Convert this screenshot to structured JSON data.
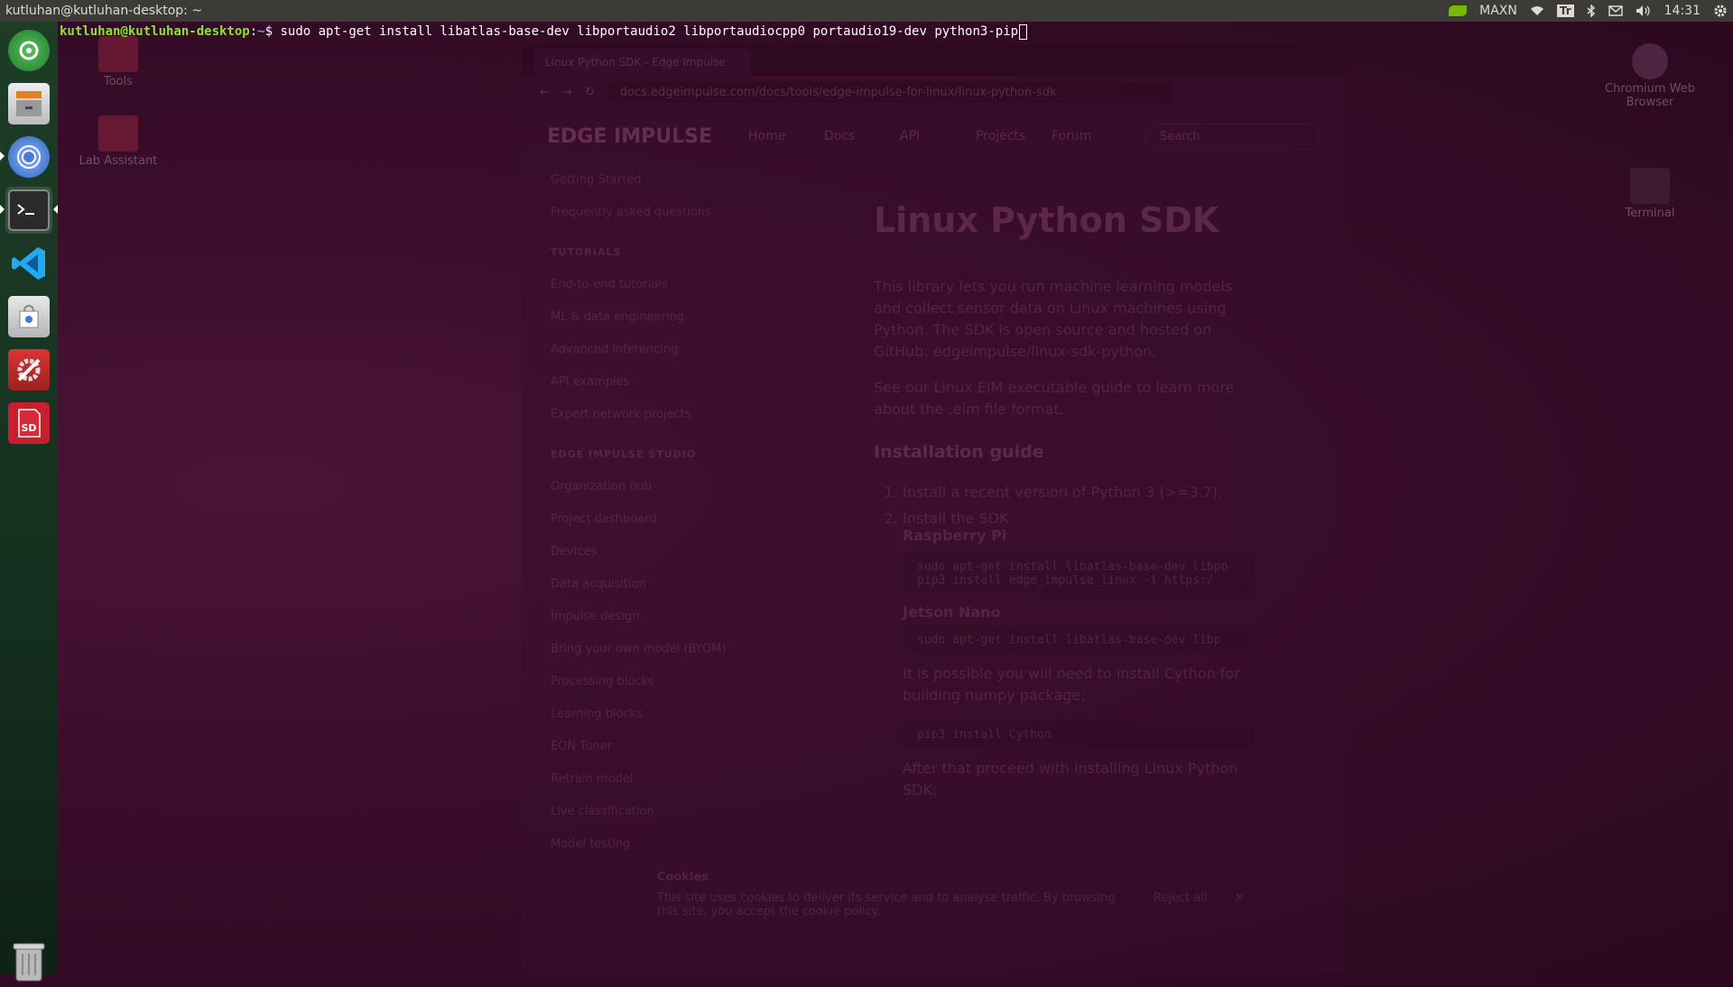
{
  "top_panel": {
    "window_title": "kutluhan@kutluhan-desktop: ~",
    "power_mode": "MAXN",
    "keyboard_layout": "Tr",
    "clock": "14:31",
    "icons": [
      "nvidia-icon",
      "wifi-icon",
      "keyboard-layout-icon",
      "bluetooth-icon",
      "mail-icon",
      "volume-icon",
      "settings-gear-icon"
    ]
  },
  "launcher": {
    "items": [
      {
        "name": "ubuntu-software-updater",
        "icon": "updater-icon"
      },
      {
        "name": "files",
        "icon": "file-cabinet-icon"
      },
      {
        "name": "chromium",
        "icon": "chromium-icon"
      },
      {
        "name": "terminal",
        "icon": "terminal-icon",
        "active": true
      },
      {
        "name": "vscode",
        "icon": "vscode-icon"
      },
      {
        "name": "software-center",
        "icon": "shopping-bag-icon"
      },
      {
        "name": "system-settings",
        "icon": "tools-icon"
      },
      {
        "name": "sd-card-formatter",
        "icon": "sd-card-icon"
      }
    ],
    "trash_icon": "trash-icon"
  },
  "desktop_icons": [
    {
      "label": "Tools"
    },
    {
      "label": "Lab Assistant"
    },
    {
      "label": "Chromium Web Browser"
    },
    {
      "label": "Terminal"
    }
  ],
  "terminal": {
    "user_host": "kutluhan@kutluhan-desktop",
    "separator": ":",
    "path": "~",
    "prompt_symbol": "$",
    "command": " sudo apt-get install libatlas-base-dev libportaudio2 libportaudiocpp0 portaudio19-dev python3-pip"
  },
  "browser": {
    "tab_title": "Linux Python SDK - Edge Impulse",
    "url": "docs.edgeimpulse.com/docs/tools/edge-impulse-for-linux/linux-python-sdk",
    "logo": "EDGE IMPULSE",
    "nav": [
      "Home",
      "Docs",
      "API",
      "Projects",
      "Forum"
    ],
    "search_placeholder": "Search",
    "sidebar": [
      "Getting Started",
      "Frequently asked questions",
      "TUTORIALS",
      "End-to-end tutorials",
      "ML & data engineering",
      "Advanced inferencing",
      "API examples",
      "Expert network projects",
      "EDGE IMPULSE STUDIO",
      "Organization hub",
      "Project dashboard",
      "Devices",
      "Data acquisition",
      "Impulse design",
      "Bring your own model (BYOM)",
      "Processing blocks",
      "Learning blocks",
      "EON Tuner",
      "Retrain model",
      "Live classification",
      "Model testing"
    ],
    "page_title": "Linux Python SDK",
    "intro_1": "This library lets you run machine learning models and collect sensor data on Linux machines using Python. The SDK is open source and hosted on GitHub: edgeimpulse/linux-sdk-python.",
    "intro_2": "See our Linux EIM executable guide to learn more about the .eim file format.",
    "section_title": "Installation guide",
    "step_1": "Install a recent version of Python 3 (>=3.7).",
    "step_2": "Install the SDK",
    "rpi_label": "Raspberry Pi",
    "rpi_code": "sudo apt-get install libatlas-base-dev libpo\npip3 install edge_impulse_linux -i https:/",
    "jetson_label": "Jetson Nano",
    "jetson_code": "sudo apt-get install libatlas-base-dev libp",
    "cython_note": "It is possible you will need to install Cython for building numpy package:",
    "cython_code": "pip3 install Cython",
    "after_note": "After that proceed with installing Linux Python SDK:",
    "cookie_title": "Cookies",
    "cookie_text": "This site uses cookies to deliver its service and to analyse traffic. By browsing this site, you accept the cookie policy.",
    "cookie_reject": "Reject all"
  }
}
